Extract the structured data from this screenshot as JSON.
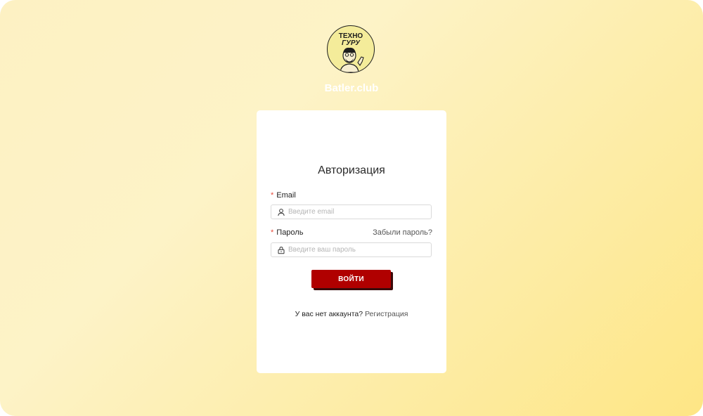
{
  "brand": {
    "logo_line1": "ТЕХНО",
    "logo_line2": "ГУРУ",
    "site_name": "Batler.club"
  },
  "auth": {
    "title": "Авторизация",
    "required_mark": "*",
    "email_label": "Email",
    "email_placeholder": "Введите email",
    "email_value": "",
    "password_label": "Пароль",
    "password_placeholder": "Введите ваш пароль",
    "password_value": "",
    "forgot_link": "Забыли пароль?",
    "submit_label": "ВОЙТИ",
    "no_account_text": "У вас нет аккаунта?",
    "register_link": "Регистрация"
  },
  "icons": {
    "email_field": "user-icon",
    "password_field": "lock-icon"
  },
  "colors": {
    "accent": "#b00000",
    "required": "#e74c3c",
    "background_start": "#fdf1c3",
    "background_end": "#fee685"
  }
}
